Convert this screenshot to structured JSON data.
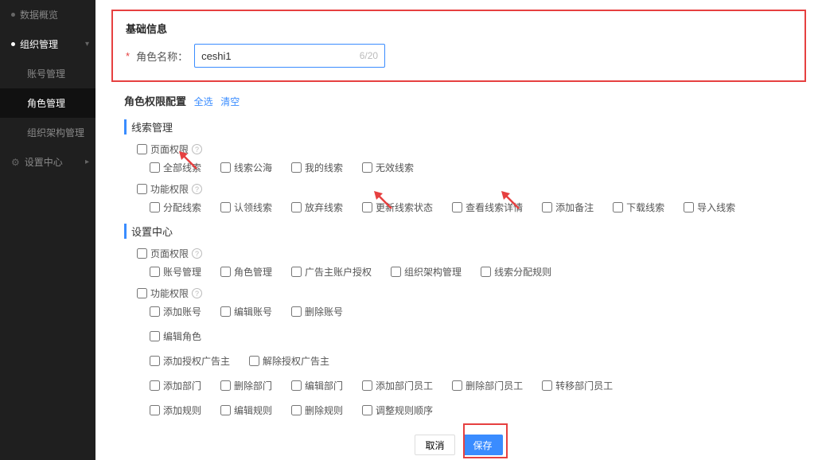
{
  "sidebar": {
    "items": [
      {
        "icon": "dashboard",
        "label": "数据概览"
      },
      {
        "icon": "org",
        "label": "组织管理"
      },
      {
        "label": "账号管理"
      },
      {
        "label": "角色管理"
      },
      {
        "label": "组织架构管理"
      },
      {
        "icon": "gear",
        "label": "设置中心"
      }
    ]
  },
  "basic_info": {
    "section_title": "基础信息",
    "role_name_label": "角色名称：",
    "role_name_value": "ceshi1",
    "role_name_counter": "6/20"
  },
  "perm": {
    "header": "角色权限配置",
    "select_all": "全选",
    "clear": "清空",
    "groups": [
      {
        "title": "线索管理",
        "blocks": [
          {
            "head": "页面权限",
            "help": true,
            "items": [
              "全部线索",
              "线索公海",
              "我的线索",
              "无效线索"
            ]
          },
          {
            "head": "功能权限",
            "help": true,
            "items": [
              "分配线索",
              "认领线索",
              "放弃线索",
              "更新线索状态",
              "查看线索详情",
              "添加备注",
              "下载线索",
              "导入线索"
            ]
          }
        ]
      },
      {
        "title": "设置中心",
        "blocks": [
          {
            "head": "页面权限",
            "help": true,
            "items": [
              "账号管理",
              "角色管理",
              "广告主账户授权",
              "组织架构管理",
              "线索分配规则"
            ]
          },
          {
            "head": "功能权限",
            "help": true,
            "rows": [
              [
                "添加账号",
                "编辑账号",
                "删除账号"
              ],
              [
                "编辑角色"
              ],
              [
                "添加授权广告主",
                "解除授权广告主"
              ],
              [
                "添加部门",
                "删除部门",
                "编辑部门",
                "添加部门员工",
                "删除部门员工",
                "转移部门员工"
              ],
              [
                "添加规则",
                "编辑规则",
                "删除规则",
                "调整规则顺序"
              ]
            ]
          }
        ]
      }
    ]
  },
  "footer": {
    "cancel": "取消",
    "save": "保存"
  }
}
